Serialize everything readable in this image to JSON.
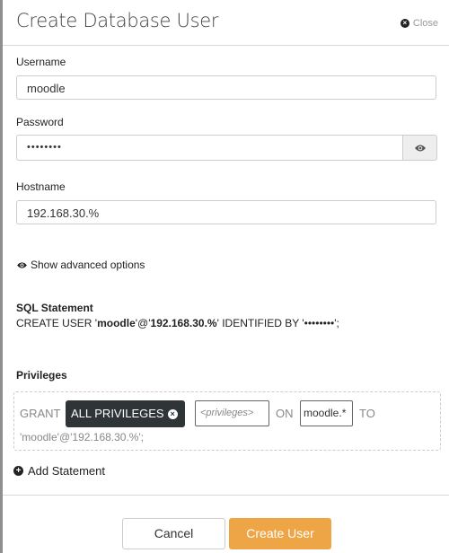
{
  "dialog": {
    "title": "Create Database User",
    "close_label": "Close",
    "close_icon": "times-circle-icon"
  },
  "form": {
    "username": {
      "label": "Username",
      "value": "moodle"
    },
    "password": {
      "label": "Password",
      "value": "••••••••",
      "toggle_icon": "eye-icon"
    },
    "hostname": {
      "label": "Hostname",
      "value": "192.168.30.%"
    },
    "advanced_label": "Show advanced options"
  },
  "sql": {
    "heading": "SQL Statement",
    "prefix": "CREATE USER '",
    "user": "moodle",
    "mid": "'@'",
    "host": "192.168.30.%",
    "suffix": "' IDENTIFIED BY '••••••••';"
  },
  "privileges": {
    "heading": "Privileges",
    "grant_kw": "GRANT",
    "chip_label": "ALL PRIVILEGES",
    "privileges_placeholder": "<privileges>",
    "on_kw": "ON",
    "database_value": "moodle.*",
    "to_kw": "TO",
    "target": "'moodle'@'192.168.30.%';",
    "add_label": "Add Statement"
  },
  "footer": {
    "cancel_label": "Cancel",
    "create_label": "Create User",
    "accent_color": "#eea546"
  }
}
